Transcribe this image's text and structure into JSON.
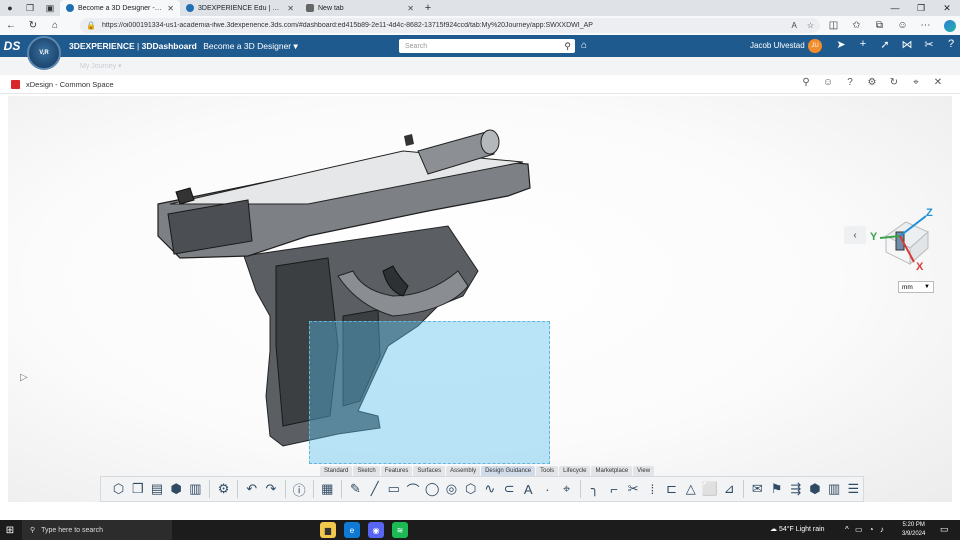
{
  "browser": {
    "tabs": [
      {
        "title": "Become a 3D Designer - My Jou",
        "active": true
      },
      {
        "title": "3DEXPERIENCE Edu | Students",
        "active": false
      },
      {
        "title": "New tab",
        "active": false
      }
    ],
    "url": "https://oi000191334-us1-academia-ifwe.3dexperience.3ds.com/#dashboard:ed415b89-2e11-4d4c-8682-13715f924ccd/tab:My%20Journey/app:SWXXDWI_AP"
  },
  "topbar": {
    "brand_bold": "3DEXPERIENCE",
    "brand_sep": " | ",
    "brand_app": "3DDashboard",
    "dashboard_name": "Become a 3D Designer",
    "search_placeholder": "Search",
    "user_name": "Jacob Ulvestad",
    "user_initials": "JU",
    "compass_label": "V,R"
  },
  "subbar": {
    "faded_text": "My Journey    ▾"
  },
  "app": {
    "title": "xDesign - Common Space"
  },
  "viewport": {
    "unit": "mm",
    "axis_labels": {
      "x": "X",
      "y": "Y",
      "z": "Z"
    }
  },
  "toolbar": {
    "tabs": [
      "Standard",
      "Sketch",
      "Features",
      "Surfaces",
      "Assembly",
      "Design Guidance",
      "Tools",
      "Lifecycle",
      "Marketplace",
      "View"
    ],
    "active_tab": "Design Guidance"
  },
  "taskbar": {
    "search_placeholder": "Type here to search",
    "weather": "54°F  Light rain",
    "time": "5:20 PM",
    "date": "3/9/2024"
  },
  "colors": {
    "topbar": "#1f5a8e",
    "selection": "#5abeeb",
    "accent": "#f28c28"
  }
}
